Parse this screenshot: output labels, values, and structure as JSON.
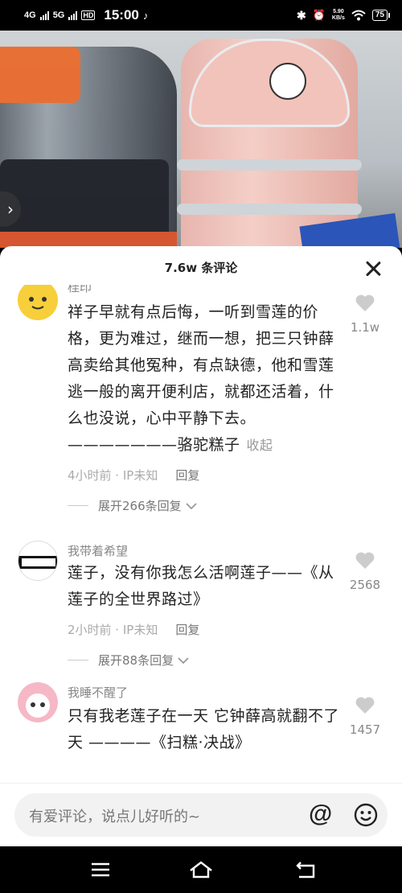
{
  "status_bar": {
    "net1": "4G",
    "net2": "5G",
    "hd": "HD",
    "time": "15:00",
    "speed_value": "5.90",
    "speed_unit": "KB/s",
    "battery": "75"
  },
  "sheet": {
    "title": "7.6w 条评论"
  },
  "comments": [
    {
      "username": "桂印",
      "text": "祥子早就有点后悔，一听到雪莲的价格，更为难过，继而一想，把三只钟薛高卖给其他冤种，有点缺德，他和雪莲逃一般的离开便利店，就都还活着，什么也没说，心中平静下去。 ———————骆驼糕子",
      "collapse_label": "收起",
      "time": "4小时前 · IP未知",
      "reply_label": "回复",
      "expand_label": "展开266条回复",
      "like_count": "1.1w"
    },
    {
      "username": "我带着希望",
      "text": "莲子，没有你我怎么活啊莲子——《从莲子的全世界路过》",
      "time": "2小时前 · IP未知",
      "reply_label": "回复",
      "expand_label": "展开88条回复",
      "like_count": "2568"
    },
    {
      "username": "我睡不醒了",
      "text": "只有我老莲子在一天 它钟薛高就翻不了天                ————《扫糕·决战》",
      "like_count": "1457"
    }
  ],
  "input": {
    "placeholder": "有爱评论，说点儿好听的~",
    "at_symbol": "@"
  }
}
